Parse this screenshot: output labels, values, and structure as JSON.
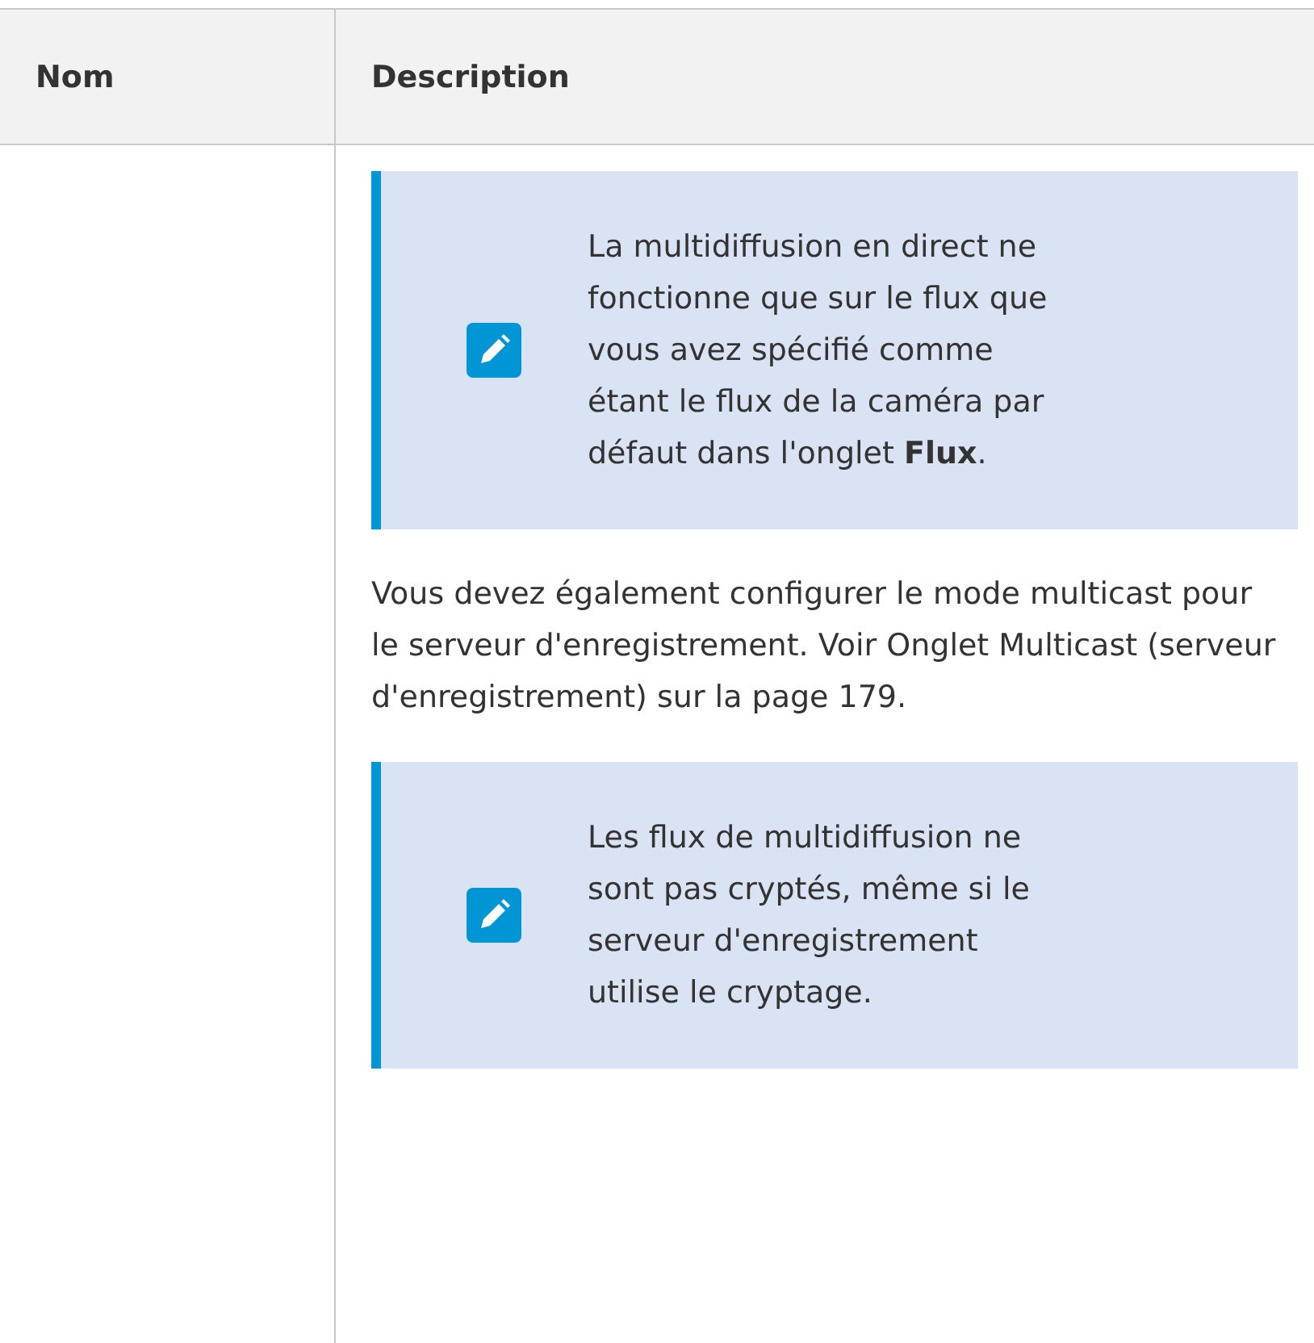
{
  "table": {
    "columns": [
      "Nom",
      "Description"
    ],
    "rows": [
      {
        "name": "",
        "description": [
          {
            "kind": "note",
            "text": "La multidiffusion en direct ne fonctionne que sur le flux que vous avez spécifié comme étant le flux de la caméra par défaut dans l'onglet **Flux**."
          },
          {
            "kind": "paragraph",
            "text": "Vous devez également configurer le mode multicast pour le serveur d'enregistrement. Voir Onglet Multicast (serveur d'enregistrement) sur la page 179."
          },
          {
            "kind": "note",
            "text": "Les flux de multidiffusion ne sont pas cryptés, même si le serveur d'enregistrement utilise le cryptage."
          }
        ]
      }
    ]
  }
}
